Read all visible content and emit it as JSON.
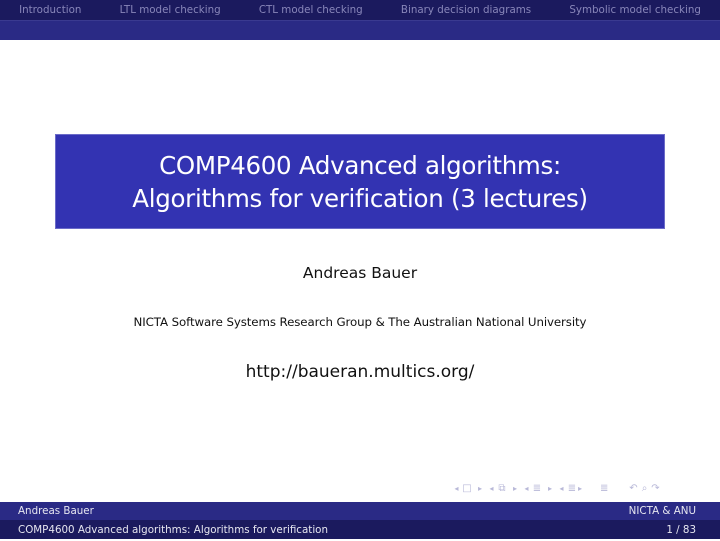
{
  "header": {
    "sections": [
      "Introduction",
      "LTL model checking",
      "CTL model checking",
      "Binary decision diagrams",
      "Symbolic model checking"
    ]
  },
  "title": {
    "line1": "COMP4600 Advanced algorithms:",
    "line2": "Algorithms for verification (3 lectures)"
  },
  "author": "Andreas Bauer",
  "institute": "NICTA Software Systems Research Group & The Australian National University",
  "url": "http://baueran.multics.org/",
  "nav_symbols": {
    "frame_prev": "◂",
    "frame_icon": "□",
    "frame_next": "▸",
    "sub_prev": "◂",
    "sub_icon": "⧉",
    "sub_next": "▸",
    "sec_prev": "◂",
    "sec_icon": "≣",
    "sec_next": "▸",
    "subsec_prev": "◂",
    "subsec_icon": "≣",
    "subsec_next": "▸",
    "toc_icon": "≣",
    "back_icon": "↶",
    "search_icon": "⌕",
    "forward_icon": "↷"
  },
  "footer": {
    "author": "Andreas Bauer",
    "institute": "NICTA & ANU",
    "short_title": "COMP4600 Advanced algorithms: Algorithms for verification",
    "page": "1 / 83"
  },
  "colors": {
    "header_dark": "#1b1a5e",
    "header_blue": "#2a2a85",
    "title_box": "#3333b2"
  }
}
